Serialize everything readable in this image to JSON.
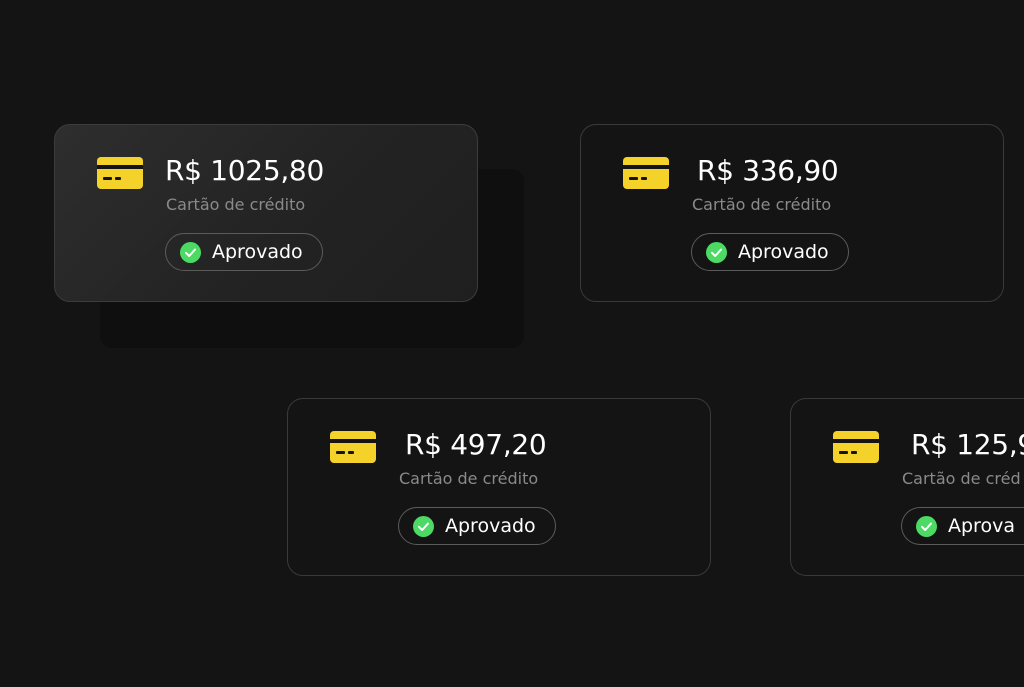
{
  "colors": {
    "background": "#141414",
    "card_icon": "#f5d229",
    "check": "#4cd964",
    "amount_text": "#ffffff",
    "secondary_text": "#8a8a8a"
  },
  "transactions": [
    {
      "amount": "R$ 1025,80",
      "method": "Cartão de crédito",
      "status": "Aprovado",
      "icon": "credit-card-icon",
      "status_icon": "check-circle-icon"
    },
    {
      "amount": "R$ 336,90",
      "method": "Cartão de crédito",
      "status": "Aprovado",
      "icon": "credit-card-icon",
      "status_icon": "check-circle-icon"
    },
    {
      "amount": "R$ 497,20",
      "method": "Cartão de crédito",
      "status": "Aprovado",
      "icon": "credit-card-icon",
      "status_icon": "check-circle-icon"
    },
    {
      "amount": "R$ 125,9",
      "method": "Cartão de créd",
      "status": "Aprova",
      "icon": "credit-card-icon",
      "status_icon": "check-circle-icon"
    }
  ]
}
